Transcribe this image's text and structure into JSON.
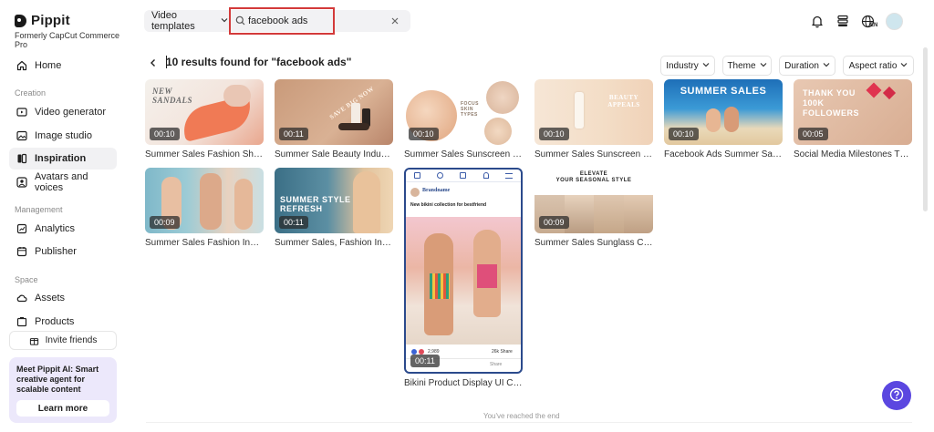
{
  "brand": {
    "name": "Pippit",
    "subtitle": "Formerly CapCut Commerce Pro"
  },
  "sidebar": {
    "home": "Home",
    "section_creation": "Creation",
    "video_generator": "Video generator",
    "image_studio": "Image studio",
    "inspiration": "Inspiration",
    "avatars": "Avatars and voices",
    "section_management": "Management",
    "analytics": "Analytics",
    "publisher": "Publisher",
    "section_space": "Space",
    "assets": "Assets",
    "products": "Products",
    "invite": "Invite friends",
    "promo_text": "Meet Pippit AI: Smart creative agent for scalable content",
    "promo_button": "Learn more"
  },
  "topbar": {
    "type_select": "Video templates",
    "search_value": "facebook ads",
    "lang": "EN"
  },
  "results": {
    "title": "10 results found for \"facebook ads\"",
    "end_text": "You've reached the end"
  },
  "filters": [
    "Industry",
    "Theme",
    "Duration",
    "Aspect ratio"
  ],
  "cards": [
    {
      "title": "Summer Sales Fashion Shoes ...",
      "duration": "00:10",
      "overlay": "NEW\nSANDALS"
    },
    {
      "title": "Summer Sale Beauty Industry...",
      "duration": "00:11",
      "overlay": "SAVE BIG NOW"
    },
    {
      "title": "Summer Sales Sunscreen Fas...",
      "duration": "00:10",
      "overlay": "FOCUS SKIN TYPES"
    },
    {
      "title": "Summer Sales Sunscreen Pro...",
      "duration": "00:10",
      "overlay": "BEAUTY APPEALS"
    },
    {
      "title": "Facebook Ads Summer Sales ...",
      "duration": "00:10",
      "overlay": "SUMMER SALES"
    },
    {
      "title": "Social Media Milestones Than...",
      "duration": "00:05",
      "overlay": "THANK YOU\n100K\nFOLLOWERS"
    },
    {
      "title": "Summer Sales Fashion Indust...",
      "duration": "00:09",
      "overlay": ""
    },
    {
      "title": "Summer Sales, Fashion Indust...",
      "duration": "00:11",
      "overlay": "SUMMER STYLE\nREFRESH"
    },
    {
      "title": "Bikini Product Display UI Crea...",
      "duration": "00:11",
      "overlay": "Brandname",
      "post_text": "New bikini collection for bestfriend",
      "likes": "2,989",
      "shares": "26k Share",
      "action": "Share"
    },
    {
      "title": "Summer Sales Sunglass Cloth...",
      "duration": "00:09",
      "overlay": "ELEVATE\nYOUR SEASONAL STYLE"
    }
  ],
  "colors": {
    "accent": "#5b47e0",
    "highlight": "#d33a3a"
  }
}
